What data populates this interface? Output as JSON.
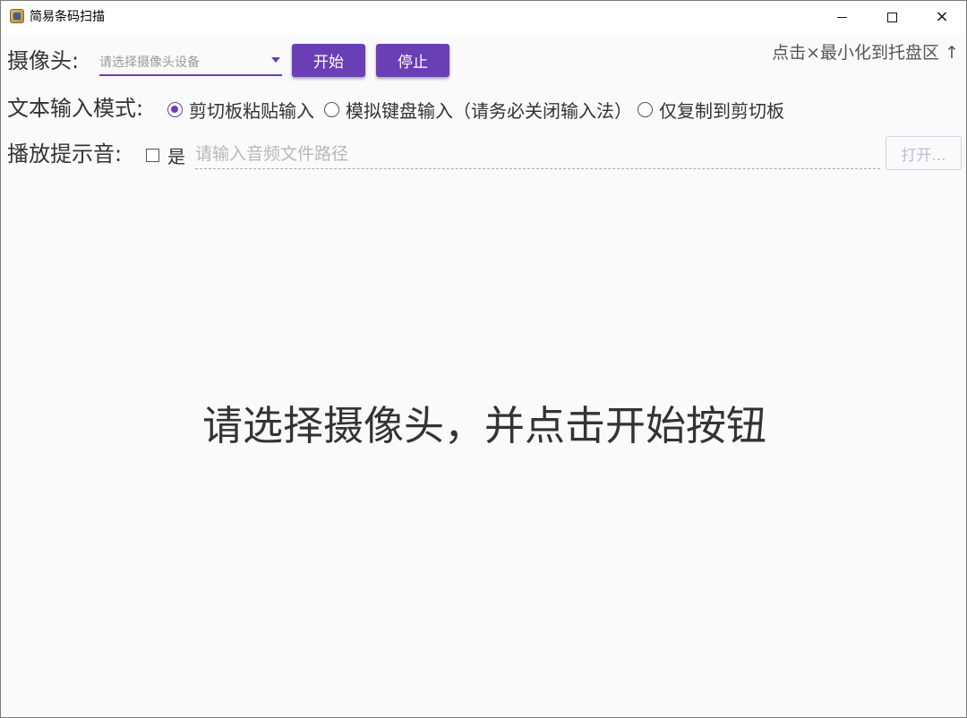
{
  "window": {
    "title": "简易条码扫描",
    "controls": {
      "minimize": "minimize",
      "maximize": "maximize",
      "close": "×"
    }
  },
  "camera": {
    "label": "摄像头:",
    "select_placeholder": "请选择摄像头设备",
    "start_button": "开始",
    "stop_button": "停止"
  },
  "tray_hint": "点击×最小化到托盘区 ↑",
  "input_mode": {
    "label": "文本输入模式:",
    "options": [
      {
        "label": "剪切板粘贴输入",
        "checked": true
      },
      {
        "label": "模拟键盘输入（请务必关闭输入法）",
        "checked": false
      },
      {
        "label": "仅复制到剪切板",
        "checked": false
      }
    ]
  },
  "sound": {
    "label": "播放提示音:",
    "checkbox_label": "是",
    "checkbox_checked": false,
    "path_placeholder": "请输入音频文件路径",
    "path_value": "",
    "open_button": "打开..."
  },
  "main_message": "请选择摄像头，并点击开始按钮",
  "colors": {
    "accent": "#6a3fb5",
    "background": "#fafafa",
    "text": "#333333",
    "disabled_text": "#c6b9e0"
  }
}
